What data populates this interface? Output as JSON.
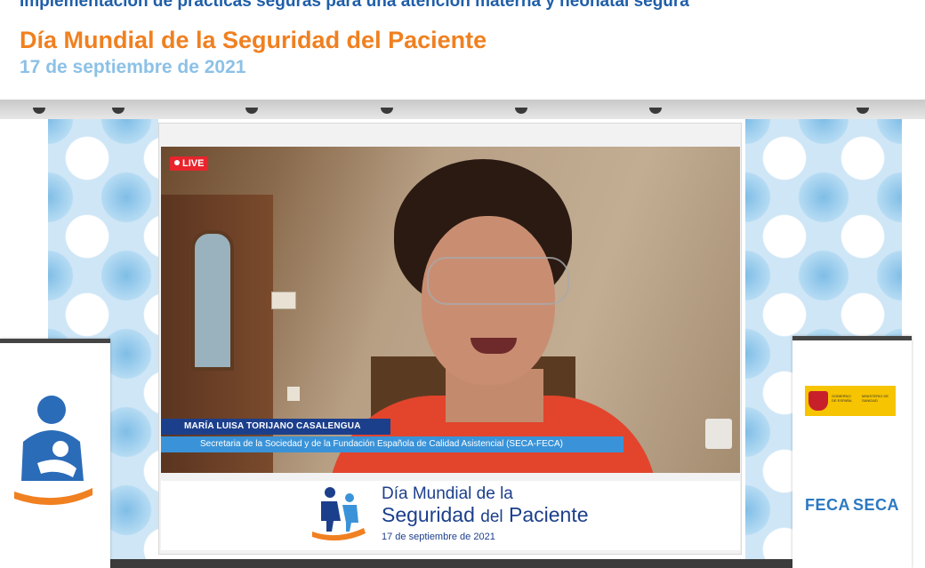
{
  "header": {
    "top_line": "Implementación de prácticas seguras para una atención materna y neonatal segura",
    "title": "Día Mundial de la Seguridad del Paciente",
    "date": "17 de septiembre de 2021"
  },
  "video": {
    "live_badge": "LIVE",
    "speaker_name": "MARÍA LUISA TORIJANO CASALENGUA",
    "speaker_role": "Secretaria de la Sociedad y de la Fundación Española de Calidad Asistencial (SECA-FECA)"
  },
  "banner": {
    "line1": "Día Mundial de la",
    "line2_main": "Seguridad",
    "line2_small": "del",
    "line2_end": "Paciente",
    "line3": "17 de septiembre de 2021"
  },
  "right_rollup": {
    "gov_line1": "GOBIERNO DE ESPAÑA",
    "gov_line2": "MINISTERIO DE SANIDAD",
    "org1": "FECA",
    "org2": "SECA"
  },
  "icons": {
    "left_rollup": "mother-child-care-icon",
    "banner": "patients-hand-icon",
    "gov": "spain-coat-of-arms-icon"
  },
  "colors": {
    "accent_orange": "#f08020",
    "dark_blue": "#1c3f8c",
    "light_blue": "#8cc1e6",
    "live_red": "#e8242c"
  }
}
